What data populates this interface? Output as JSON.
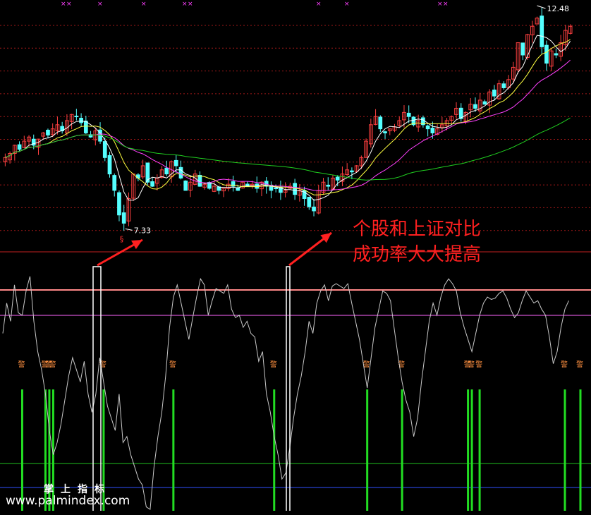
{
  "annotations": {
    "caption_line1": "个股和上证对比",
    "caption_line2": "成功率大大提高",
    "brand_cn": "掌上指标",
    "brand_url": "www.palmindex.com",
    "price_high_label": "12.48",
    "price_low_label": "7.33",
    "signal_marker": "§",
    "signal_label": "警"
  },
  "colors": {
    "background": "#000000",
    "up_candle": "#ff4040",
    "down_candle": "#54ffff",
    "ma_short": "#ffffff",
    "ma_mid": "#ffff40",
    "ma_long": "#ff40ff",
    "ma_longest": "#20d020",
    "grid": "#a01818",
    "arrow": "#ff2020",
    "signal_bar": "#22dd22",
    "oscillator": "#c8c8c8",
    "level_high": "#ff8888",
    "level_low_green": "#20c020",
    "level_low_blue": "#3050ff"
  },
  "chart_data": [
    {
      "type": "candlestick",
      "price_high_marker": 12.48,
      "price_low_marker": 7.33,
      "closes": [
        9.0,
        9.1,
        9.3,
        9.2,
        9.4,
        9.5,
        9.3,
        9.45,
        9.6,
        9.55,
        9.7,
        9.8,
        9.65,
        9.9,
        10.05,
        10.0,
        9.85,
        9.6,
        9.5,
        9.65,
        9.4,
        9.0,
        8.6,
        8.2,
        7.6,
        7.4,
        8.0,
        8.6,
        8.5,
        8.8,
        8.4,
        8.3,
        8.5,
        8.7,
        8.6,
        8.9,
        8.8,
        8.5,
        8.2,
        8.4,
        8.6,
        8.3,
        8.35,
        8.25,
        8.3,
        8.2,
        8.25,
        8.35,
        8.3,
        8.2,
        8.4,
        8.3,
        8.35,
        8.25,
        8.4,
        8.3,
        8.2,
        8.25,
        8.15,
        8.2,
        8.3,
        8.1,
        8.2,
        8.0,
        7.8,
        7.7,
        8.2,
        8.4,
        8.3,
        8.5,
        8.45,
        8.6,
        8.7,
        8.65,
        8.8,
        9.0,
        9.4,
        9.8,
        10.0,
        9.7,
        9.6,
        9.7,
        9.75,
        9.9,
        10.1,
        10.0,
        9.8,
        9.9,
        9.8,
        9.7,
        9.6,
        9.7,
        9.8,
        9.9,
        10.0,
        10.2,
        9.95,
        10.1,
        10.3,
        10.2,
        10.4,
        10.3,
        10.6,
        10.5,
        10.8,
        10.7,
        10.9,
        11.2,
        11.8,
        11.5,
        12.0,
        12.2,
        12.4,
        11.7,
        11.3,
        11.6,
        11.5,
        11.8,
        12.1,
        12.2
      ]
    },
    {
      "type": "line",
      "levels": [
        96,
        80,
        10,
        0
      ],
      "osc": [
        45,
        70,
        55,
        85,
        62,
        60,
        80,
        92,
        55,
        30,
        15,
        -5,
        -35,
        -55,
        -45,
        -30,
        -10,
        10,
        25,
        15,
        5,
        22,
        -5,
        -20,
        -5,
        25,
        5,
        -15,
        -25,
        -35,
        -5,
        -45,
        -40,
        -55,
        -65,
        -75,
        -80,
        -98,
        -100,
        -65,
        -40,
        -20,
        10,
        50,
        75,
        85,
        70,
        55,
        40,
        58,
        75,
        90,
        85,
        60,
        72,
        82,
        80,
        78,
        85,
        65,
        58,
        60,
        50,
        55,
        45,
        42,
        22,
        30,
        -5,
        -20,
        -40,
        -55,
        -75,
        -70,
        -50,
        -25,
        -5,
        10,
        30,
        55,
        45,
        70,
        80,
        85,
        72,
        84,
        86,
        84,
        82,
        86,
        70,
        55,
        40,
        20,
        0,
        25,
        50,
        65,
        80,
        78,
        72,
        48,
        25,
        5,
        -10,
        -20,
        -40,
        -25,
        5,
        30,
        55,
        70,
        60,
        75,
        85,
        90,
        86,
        80,
        62,
        50,
        40,
        30,
        45,
        60,
        70,
        75,
        73,
        74,
        78,
        80,
        74,
        65,
        58,
        62,
        72,
        80,
        75,
        70,
        72,
        65,
        60,
        42,
        20,
        30,
        50,
        65,
        72
      ],
      "signal_indices": [
        4,
        9,
        10,
        11,
        21,
        36,
        57,
        77,
        84,
        98,
        99,
        100,
        118,
        122
      ]
    }
  ]
}
